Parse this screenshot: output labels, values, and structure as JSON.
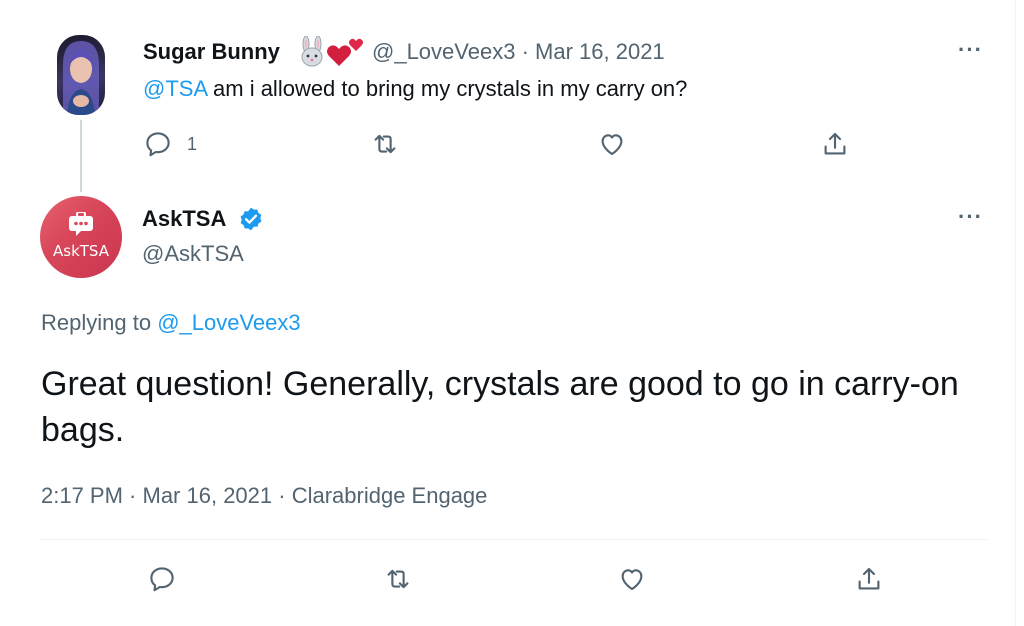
{
  "parent_tweet": {
    "author_name": "Sugar Bunny",
    "emojis": [
      "rabbit-emoji",
      "two-hearts-emoji"
    ],
    "handle": "@_LoveVeex3",
    "separator": "·",
    "date": "Mar 16, 2021",
    "mention": "@TSA",
    "text": " am i allowed to bring my crystals in my carry on?",
    "more": "···",
    "actions": {
      "reply_count": "1"
    }
  },
  "main_tweet": {
    "avatar_text": "AskTSA",
    "author_name": "AskTSA",
    "handle": "@AskTSA",
    "more": "···",
    "replying_prefix": "Replying to ",
    "replying_to": "@_LoveVeex3",
    "text": "Great question! Generally, crystals are good to go in carry-on bags.",
    "time": "2:17 PM",
    "separator": " · ",
    "date": "Mar 16, 2021",
    "source": "Clarabridge Engage"
  },
  "colors": {
    "link": "#1d9bf0",
    "secondary_text": "#536471",
    "verified": "#1d9bf0",
    "avatar_brand": "#d9475b"
  },
  "icons": {
    "reply": "reply-icon",
    "retweet": "retweet-icon",
    "like": "like-icon",
    "share": "share-icon",
    "verified": "verified-badge-icon"
  }
}
